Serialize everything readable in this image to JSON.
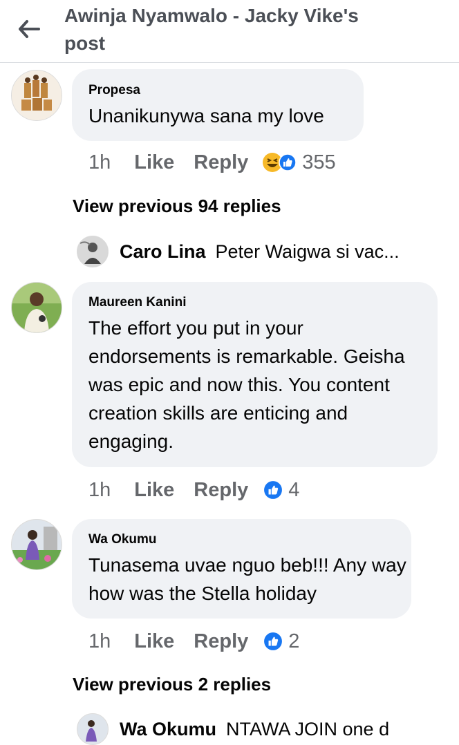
{
  "header": {
    "title": "Awinja Nyamwalo - Jacky Vike's post"
  },
  "comments": [
    {
      "author": "Propesa",
      "text": "Unanikunywa sana my love",
      "time": "1h",
      "like": "Like",
      "reply": "Reply",
      "reactions": [
        "haha-icon",
        "like-icon"
      ],
      "count": "355"
    },
    {
      "author": "Maureen Kanini",
      "text": "The effort you put in your endorsements is remarkable. Geisha was epic and now this. You content creation skills are enticing and engaging.",
      "time": "1h",
      "like": "Like",
      "reply": "Reply",
      "reactions": [
        "like-icon"
      ],
      "count": "4"
    },
    {
      "author": "Wa Okumu",
      "text": "Tunasema uvae nguo beb!!! Any way how was the Stella holiday",
      "time": "1h",
      "like": "Like",
      "reply": "Reply",
      "reactions": [
        "like-icon"
      ],
      "count": "2"
    }
  ],
  "view_previous_1": "View previous 94 replies",
  "view_previous_2": "View previous 2 replies",
  "reply_previews": [
    {
      "author": "Caro Lina",
      "text": "Peter Waigwa si vac..."
    },
    {
      "author": "Wa Okumu",
      "text": "NTAWA JOIN one d"
    }
  ],
  "colors": {
    "bubble": "#f0f2f5",
    "meta": "#65676b",
    "like_blue": "#1877f2",
    "haha_yellow": "#f7b928"
  }
}
